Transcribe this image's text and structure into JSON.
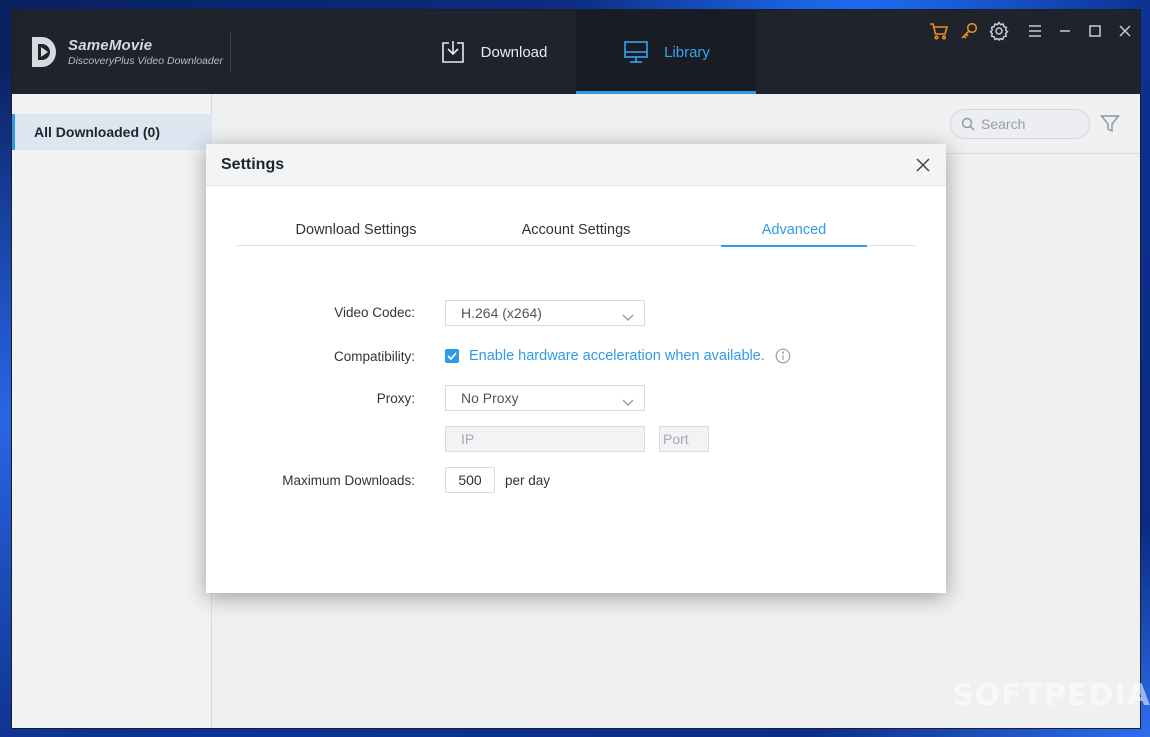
{
  "app": {
    "brand_name": "SameMovie",
    "brand_subtitle": "DiscoveryPlus Video Downloader"
  },
  "nav": {
    "download_label": "Download",
    "library_label": "Library",
    "active": "library"
  },
  "window_controls": {
    "icons": [
      "cart-icon",
      "key-icon",
      "gear-icon",
      "menu-icon",
      "minimize-icon",
      "maximize-icon",
      "close-icon"
    ],
    "accent_color": "#f08c1e"
  },
  "sidebar": {
    "items": [
      {
        "label": "All Downloaded (0)",
        "active": true
      }
    ]
  },
  "main": {
    "search_placeholder": "Search"
  },
  "dialog": {
    "title": "Settings",
    "tabs": [
      {
        "label": "Download Settings",
        "active": false
      },
      {
        "label": "Account Settings",
        "active": false
      },
      {
        "label": "Advanced",
        "active": true
      }
    ],
    "fields": {
      "video_codec_label": "Video Codec:",
      "video_codec_value": "H.264 (x264)",
      "compatibility_label": "Compatibility:",
      "hw_accel_text": "Enable hardware acceleration when available.",
      "hw_accel_checked": true,
      "proxy_label": "Proxy:",
      "proxy_value": "No Proxy",
      "ip_placeholder": "IP",
      "port_placeholder": "Port",
      "max_downloads_label": "Maximum Downloads:",
      "max_downloads_value": "500",
      "per_day": "per day"
    }
  },
  "colors": {
    "accent": "#2f9be6",
    "titlebar": "#1f232c",
    "sidebar_active_bg": "#dde6f0"
  },
  "watermark": "SOFTPEDIA"
}
